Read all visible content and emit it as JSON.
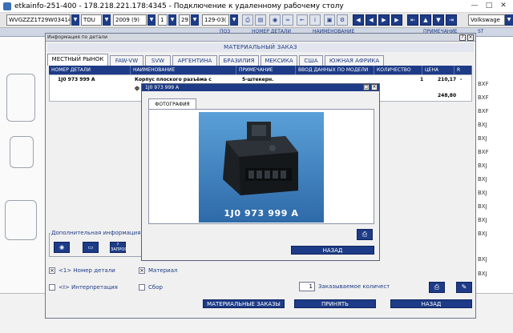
{
  "window": {
    "title": "etkainfo-251-400 - 178.218.221.178:4345 - Подключение к удаленному рабочему столу"
  },
  "toolbar": {
    "vin": "WVGZZZ1T29W03414",
    "brand": "TOU",
    "year": "2009 (9)",
    "sel1": "1",
    "sel2": "29",
    "code": "129-03(",
    "make": "Volkswage"
  },
  "background_header": [
    "ПОЗ",
    "НОМЕР ДЕТАЛИ",
    "НАИМЕНОВАНИЕ",
    "ПРИМЕЧАНИЕ",
    "ST"
  ],
  "background_codes": [
    "BXF",
    "BXF",
    "BXF",
    "BXJ",
    "BXJ",
    "BXF",
    "BXJ",
    "BXJ",
    "BXJ",
    "BXJ",
    "BXJ",
    "BXJ",
    "BXJ",
    "BXJ"
  ],
  "dialog": {
    "title": "Информация по детали",
    "section": "МАТЕРИАЛЬНЫЙ ЗАКАЗ",
    "tabs": [
      "МЕСТНЫЙ РЫНОК",
      "FAW-VW",
      "SVW",
      "АРГЕНТИНА",
      "БРАЗИЛИЯ",
      "МЕКСИКА",
      "США",
      "ЮЖНАЯ АФРИКА"
    ],
    "columns": [
      "НОМЕР ДЕТАЛИ",
      "НАИМЕНОВАНИЕ",
      "ПРИМЕЧАНИЕ",
      "ВВОД ДАННЫХ ПО МОДЕЛИ",
      "КОЛИЧЕСТВО",
      "ЦЕНА",
      "R"
    ],
    "row": {
      "part_no": "1J0 973 999 A",
      "name": "Корпус плоского разъёма с",
      "name2": "ф",
      "note": "5-штекерн.",
      "qty": "1",
      "price": "210,17",
      "r": "-",
      "total": "248,80"
    },
    "additional_info": "Дополнительная информация",
    "icon_btn3_label": "ЗАПРОС",
    "checks": {
      "part_number": "<1> Номер детали",
      "material": "Материал",
      "interpretation": "<I> Интерпретация",
      "collect": "Сбор"
    },
    "order_qty_value": "1",
    "order_qty_label": "Заказываемое количест",
    "buttons": {
      "material_orders": "МАТЕРИАЛЬНЫЕ ЗАКАЗЫ",
      "accept": "ПРИНЯТЬ",
      "back": "НАЗАД"
    }
  },
  "photo_dialog": {
    "title": "1J0 973 999 A",
    "tab": "ФОТОГРАФИЯ",
    "part_label": "1J0 973 999 A",
    "back_button": "НАЗАД"
  }
}
